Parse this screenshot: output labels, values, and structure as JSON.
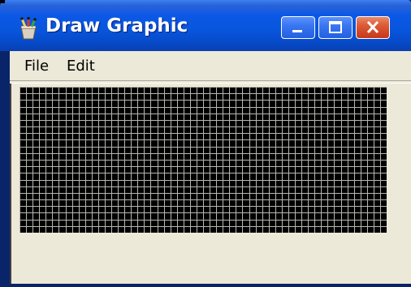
{
  "window": {
    "title": "Draw Graphic",
    "icon": "paintbrush-cup-icon",
    "controls": {
      "minimize_icon": "minimize-icon",
      "maximize_icon": "maximize-icon",
      "close_icon": "close-icon"
    }
  },
  "menu": {
    "items": [
      {
        "label": "File"
      },
      {
        "label": "Edit"
      }
    ]
  },
  "canvas": {
    "background_color": "#000000",
    "grid_line_color": "#b8b8b0",
    "columns": 56,
    "rows": 22
  },
  "colors": {
    "titlebar": "#0855dd",
    "client_background": "#ece9d8",
    "close_button": "#dc5a36"
  }
}
